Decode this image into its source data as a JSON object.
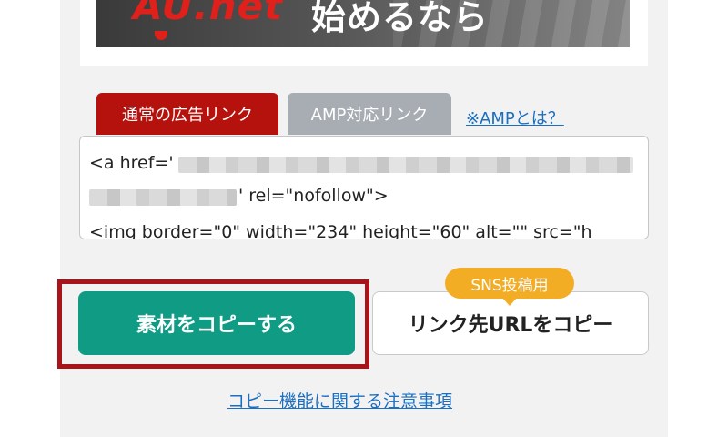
{
  "banner": {
    "logo_text": "AU.net",
    "tagline": "始めるなら"
  },
  "tabs": {
    "normal_label": "通常の広告リンク",
    "amp_label": "AMP対応リンク",
    "amp_help_link": "※AMPとは？"
  },
  "code": {
    "line1_prefix": "<a href='",
    "line2_suffix": "' rel=\"nofollow\">",
    "line3": "<img border=\"0\" width=\"234\" height=\"60\" alt=\"\" src=\"h"
  },
  "actions": {
    "copy_material_label": "素材をコピーする",
    "copy_link_label": "リンク先URLをコピー",
    "sns_badge": "SNS投稿用"
  },
  "footer": {
    "notes_link": "コピー機能に関する注意事項"
  },
  "colors": {
    "tab_active": "#b5120e",
    "tab_inactive": "#a7adb3",
    "primary_button": "#109b84",
    "badge": "#f3ad25",
    "highlight_frame": "#a8141a",
    "link": "#1b6fc0"
  }
}
